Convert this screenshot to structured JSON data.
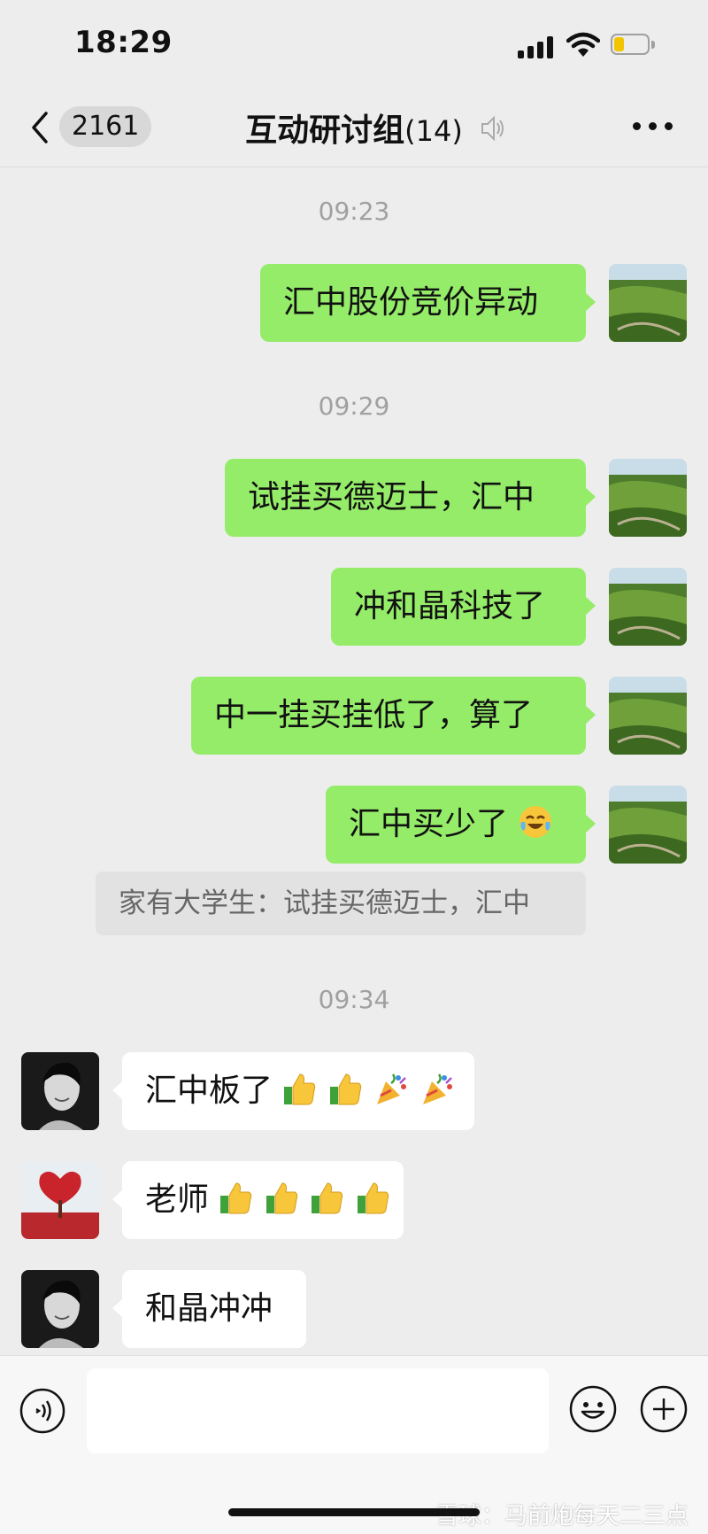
{
  "status_bar": {
    "time": "18:29",
    "signal_icon": "cellular-signal-icon",
    "wifi_icon": "wifi-icon",
    "battery_icon": "battery-icon",
    "battery_level": 0.3,
    "battery_color": "#f2c500"
  },
  "nav": {
    "back_icon": "chevron-left-icon",
    "unread_count": "2161",
    "title": "互动研讨组",
    "member_count": "(14)",
    "mute_icon": "mute-icon",
    "more_icon": "more-dots-icon"
  },
  "colors": {
    "outgoing_bubble": "#95ec69",
    "incoming_bubble": "#ffffff",
    "background": "#ededed"
  },
  "messages": {
    "t1": "09:23",
    "m1": "汇中股份竞价异动",
    "t2": "09:29",
    "m2": "试挂买德迈士，汇中",
    "m3": "冲和晶科技了",
    "m4": "中一挂买挂低了，算了",
    "m5": "汇中买少了",
    "m5_emoji": "laughing-crying-emoji",
    "quote": "家有大学生：试挂买德迈士，汇中",
    "t3": "09:34",
    "m6": "汇中板了",
    "m6_emojis": [
      "thumbs-up-emoji",
      "thumbs-up-emoji",
      "party-popper-emoji",
      "party-popper-emoji"
    ],
    "m7": "老师",
    "m7_emojis": [
      "thumbs-up-emoji",
      "thumbs-up-emoji",
      "thumbs-up-emoji",
      "thumbs-up-emoji"
    ],
    "m8": "和晶冲冲"
  },
  "input_bar": {
    "voice_icon": "voice-input-icon",
    "emoji_icon": "emoji-smiley-icon",
    "add_icon": "add-circle-icon"
  },
  "watermark": "雪球：马前炮每天二三点"
}
